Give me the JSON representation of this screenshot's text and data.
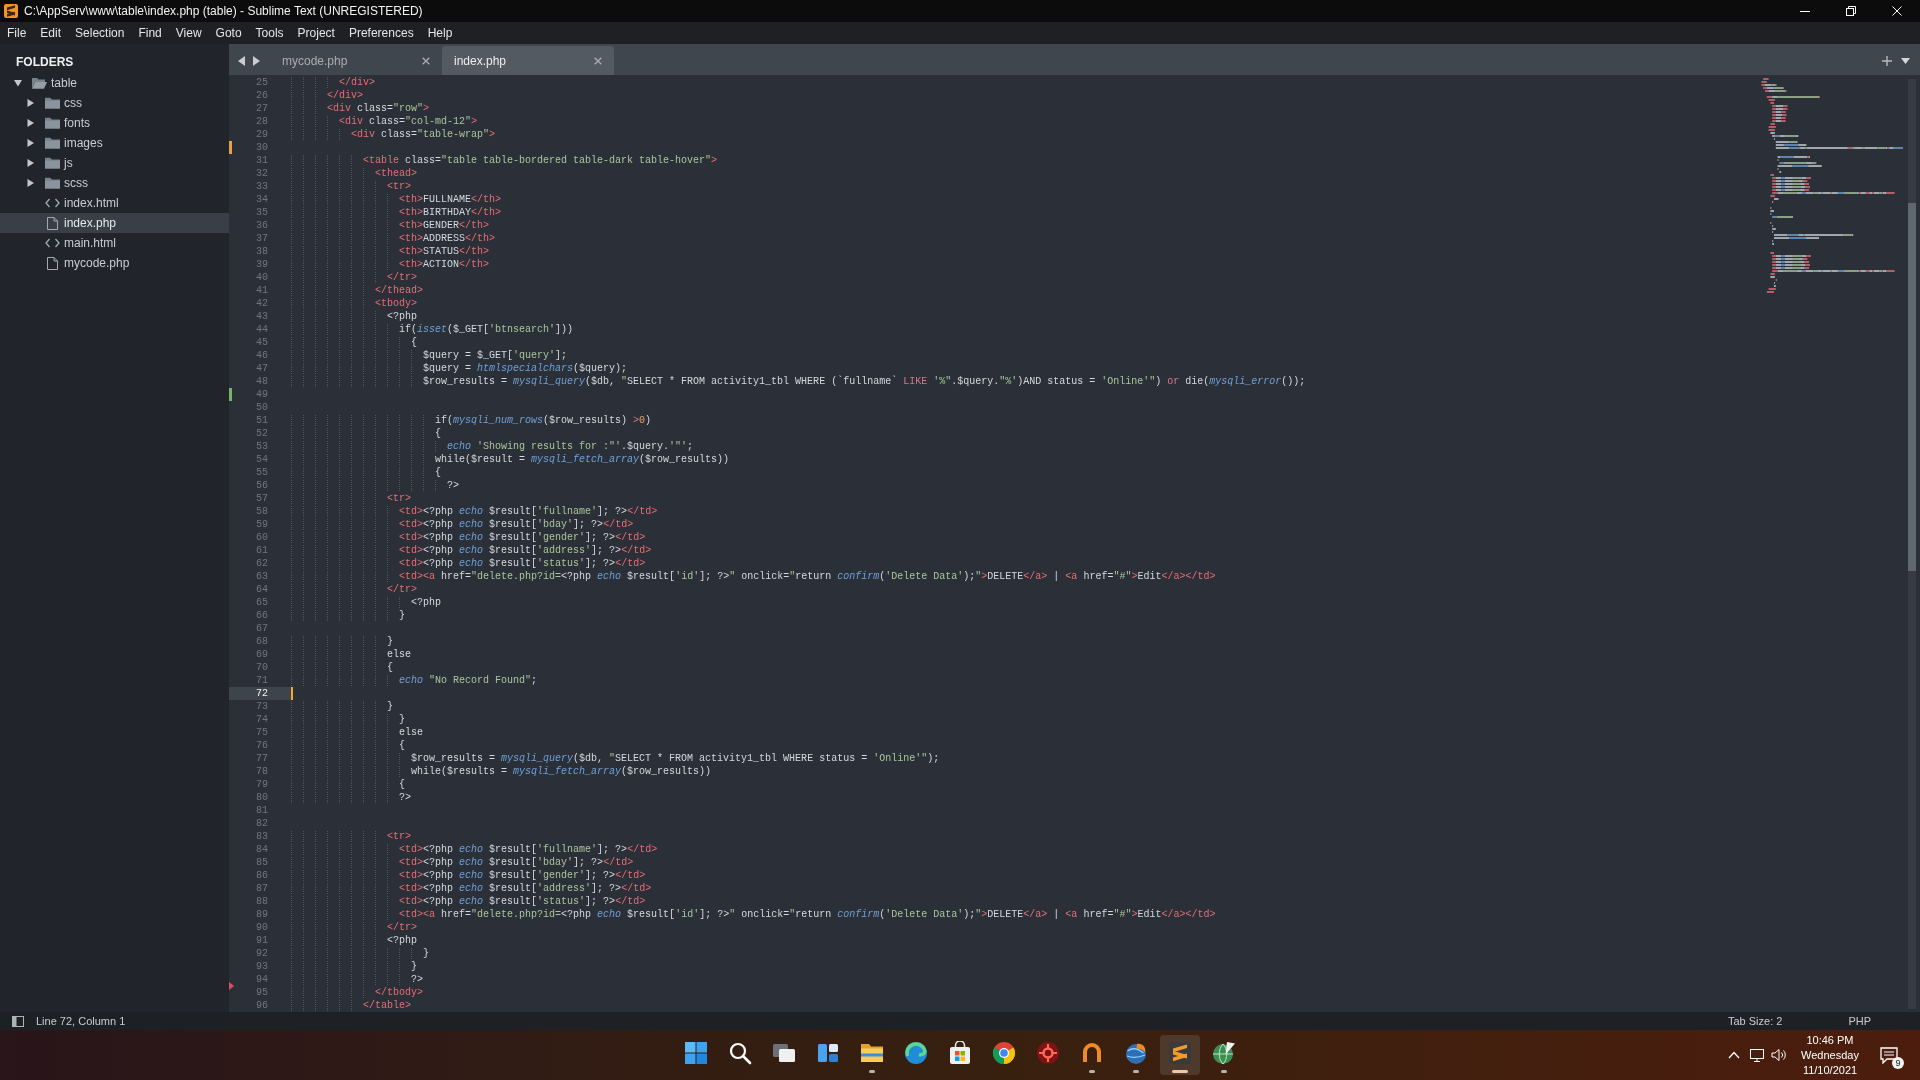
{
  "window": {
    "title": "C:\\AppServ\\www\\table\\index.php (table) - Sublime Text (UNREGISTERED)"
  },
  "menu": [
    "File",
    "Edit",
    "Selection",
    "Find",
    "View",
    "Goto",
    "Tools",
    "Project",
    "Preferences",
    "Help"
  ],
  "sidebar": {
    "header": "FOLDERS",
    "tree": [
      {
        "label": "table",
        "kind": "folder",
        "expanded": true,
        "selected": false,
        "children": [
          {
            "label": "css",
            "kind": "folder",
            "expanded": false,
            "selected": false
          },
          {
            "label": "fonts",
            "kind": "folder",
            "expanded": false,
            "selected": false
          },
          {
            "label": "images",
            "kind": "folder",
            "expanded": false,
            "selected": false
          },
          {
            "label": "js",
            "kind": "folder",
            "expanded": false,
            "selected": false
          },
          {
            "label": "scss",
            "kind": "folder",
            "expanded": false,
            "selected": false
          },
          {
            "label": "index.html",
            "kind": "markup",
            "selected": false
          },
          {
            "label": "index.php",
            "kind": "file",
            "selected": true
          },
          {
            "label": "main.html",
            "kind": "markup",
            "selected": false
          },
          {
            "label": "mycode.php",
            "kind": "file",
            "selected": false
          }
        ]
      }
    ]
  },
  "tabs": [
    {
      "label": "mycode.php",
      "selected": false
    },
    {
      "label": "index.php",
      "selected": true
    }
  ],
  "editor": {
    "lines": [
      {
        "number": "25",
        "kind": "plain",
        "current": false,
        "tokens": [
          {
            "kind": "tag",
            "text": "        </div>"
          }
        ]
      },
      {
        "number": "26",
        "kind": "plain",
        "current": false,
        "tokens": [
          {
            "kind": "tag",
            "text": "      </div>"
          }
        ]
      },
      {
        "number": "27",
        "kind": "plain",
        "current": false,
        "tokens": [
          {
            "kind": "tag",
            "text": "      <div"
          },
          {
            "kind": "txt",
            "text": " class="
          },
          {
            "kind": "str",
            "text": "\"row\""
          },
          {
            "kind": "tag",
            "text": ">"
          }
        ]
      },
      {
        "number": "28",
        "kind": "plain",
        "current": false,
        "tokens": [
          {
            "kind": "tag",
            "text": "        <div"
          },
          {
            "kind": "txt",
            "text": " class="
          },
          {
            "kind": "str",
            "text": "\"col-md-12\""
          },
          {
            "kind": "tag",
            "text": ">"
          }
        ]
      },
      {
        "number": "29",
        "kind": "plain",
        "current": false,
        "tokens": [
          {
            "kind": "tag",
            "text": "          <div"
          },
          {
            "kind": "txt",
            "text": " class="
          },
          {
            "kind": "str",
            "text": "\"table-wrap\""
          },
          {
            "kind": "tag",
            "text": ">"
          }
        ]
      },
      {
        "number": "30",
        "kind": "modified",
        "current": false
      },
      {
        "number": "31",
        "kind": "plain",
        "current": false,
        "tokens": [
          {
            "kind": "tag",
            "text": "            <table"
          },
          {
            "kind": "txt",
            "text": " class="
          },
          {
            "kind": "str",
            "text": "\"table table-bordered table-dark table-hover\""
          },
          {
            "kind": "tag",
            "text": ">"
          }
        ]
      },
      {
        "number": "32",
        "kind": "plain",
        "current": false,
        "tokens": [
          {
            "kind": "tag",
            "text": "              <thead>"
          }
        ]
      },
      {
        "number": "33",
        "kind": "plain",
        "current": false,
        "tokens": [
          {
            "kind": "tag",
            "text": "                <tr>"
          }
        ]
      },
      {
        "number": "34",
        "kind": "plain",
        "current": false,
        "tokens": [
          {
            "kind": "tag",
            "text": "                  <th>"
          },
          {
            "kind": "txt",
            "text": "FULLNAME"
          },
          {
            "kind": "tag",
            "text": "</th>"
          }
        ]
      },
      {
        "number": "35",
        "kind": "plain",
        "current": false,
        "tokens": [
          {
            "kind": "tag",
            "text": "                  <th>"
          },
          {
            "kind": "txt",
            "text": "BIRTHDAY"
          },
          {
            "kind": "tag",
            "text": "</th>"
          }
        ]
      },
      {
        "number": "36",
        "kind": "plain",
        "current": false,
        "tokens": [
          {
            "kind": "tag",
            "text": "                  <th>"
          },
          {
            "kind": "txt",
            "text": "GENDER"
          },
          {
            "kind": "tag",
            "text": "</th>"
          }
        ]
      },
      {
        "number": "37",
        "kind": "plain",
        "current": false,
        "tokens": [
          {
            "kind": "tag",
            "text": "                  <th>"
          },
          {
            "kind": "txt",
            "text": "ADDRESS"
          },
          {
            "kind": "tag",
            "text": "</th>"
          }
        ]
      },
      {
        "number": "38",
        "kind": "plain",
        "current": false,
        "tokens": [
          {
            "kind": "tag",
            "text": "                  <th>"
          },
          {
            "kind": "txt",
            "text": "STATUS"
          },
          {
            "kind": "tag",
            "text": "</th>"
          }
        ]
      },
      {
        "number": "39",
        "kind": "plain",
        "current": false,
        "tokens": [
          {
            "kind": "tag",
            "text": "                  <th>"
          },
          {
            "kind": "txt",
            "text": "ACTION"
          },
          {
            "kind": "tag",
            "text": "</th>"
          }
        ]
      },
      {
        "number": "40",
        "kind": "plain",
        "current": false,
        "tokens": [
          {
            "kind": "tag",
            "text": "                </tr>"
          }
        ]
      },
      {
        "number": "41",
        "kind": "plain",
        "current": false,
        "tokens": [
          {
            "kind": "tag",
            "text": "              </thead>"
          }
        ]
      },
      {
        "number": "42",
        "kind": "plain",
        "current": false,
        "tokens": [
          {
            "kind": "tag",
            "text": "              <tbody>"
          }
        ]
      },
      {
        "number": "43",
        "kind": "plain",
        "current": false,
        "tokens": [
          {
            "kind": "txt",
            "text": "                <?php"
          }
        ]
      },
      {
        "number": "44",
        "kind": "plain",
        "current": false,
        "tokens": [
          {
            "kind": "txt",
            "text": "                  if("
          },
          {
            "kind": "fn",
            "text": "isset"
          },
          {
            "kind": "txt",
            "text": "($_GET["
          },
          {
            "kind": "str",
            "text": "'btnsearch'"
          },
          {
            "kind": "txt",
            "text": "]))"
          }
        ]
      },
      {
        "number": "45",
        "kind": "plain",
        "current": false,
        "tokens": [
          {
            "kind": "txt",
            "text": "                    {"
          }
        ]
      },
      {
        "number": "46",
        "kind": "plain",
        "current": false,
        "tokens": [
          {
            "kind": "txt",
            "text": "                      $query = $_GET["
          },
          {
            "kind": "str",
            "text": "'query'"
          },
          {
            "kind": "txt",
            "text": "];"
          }
        ]
      },
      {
        "number": "47",
        "kind": "plain",
        "current": false,
        "tokens": [
          {
            "kind": "txt",
            "text": "                      $query = "
          },
          {
            "kind": "fn",
            "text": "htmlspecialchars"
          },
          {
            "kind": "txt",
            "text": "($query);"
          }
        ]
      },
      {
        "number": "48",
        "kind": "plain",
        "current": false,
        "tokens": [
          {
            "kind": "txt",
            "text": "                      $row_results = "
          },
          {
            "kind": "fn",
            "text": "mysqli_query"
          },
          {
            "kind": "txt",
            "text": "($db, "
          },
          {
            "kind": "str",
            "text": "\""
          },
          {
            "kind": "txt",
            "text": "SELECT * FROM activity1_tbl WHERE (`fullname` "
          },
          {
            "kind": "kw",
            "text": "LIKE "
          },
          {
            "kind": "str",
            "text": "'%\""
          },
          {
            "kind": "txt",
            "text": ".$query."
          },
          {
            "kind": "str",
            "text": "\"%'"
          },
          {
            "kind": "txt",
            "text": ")AND status = "
          },
          {
            "kind": "str",
            "text": "'Online'\""
          },
          {
            "kind": "txt",
            "text": ") "
          },
          {
            "kind": "kw",
            "text": "or"
          },
          {
            "kind": "txt",
            "text": " die("
          },
          {
            "kind": "fn",
            "text": "mysqli_error"
          },
          {
            "kind": "txt",
            "text": "());"
          }
        ]
      },
      {
        "number": "49",
        "kind": "added",
        "current": false
      },
      {
        "number": "50",
        "kind": "plain",
        "current": false
      },
      {
        "number": "51",
        "kind": "plain",
        "current": false,
        "tokens": [
          {
            "kind": "txt",
            "text": "                        if("
          },
          {
            "kind": "fn",
            "text": "mysqli_num_rows"
          },
          {
            "kind": "txt",
            "text": "($row_results) "
          },
          {
            "kind": "kw",
            "text": ">"
          },
          {
            "kind": "num",
            "text": "0"
          },
          {
            "kind": "txt",
            "text": ")"
          }
        ]
      },
      {
        "number": "52",
        "kind": "plain",
        "current": false,
        "tokens": [
          {
            "kind": "txt",
            "text": "                        {"
          }
        ]
      },
      {
        "number": "53",
        "kind": "plain",
        "current": false,
        "tokens": [
          {
            "kind": "fn",
            "text": "                          echo "
          },
          {
            "kind": "str",
            "text": "'Showing results for :\"'"
          },
          {
            "kind": "txt",
            "text": ".$query."
          },
          {
            "kind": "str",
            "text": "'\"'"
          },
          {
            "kind": "txt",
            "text": ";"
          }
        ]
      },
      {
        "number": "54",
        "kind": "plain",
        "current": false,
        "tokens": [
          {
            "kind": "txt",
            "text": "                        while($result = "
          },
          {
            "kind": "fn",
            "text": "mysqli_fetch_array"
          },
          {
            "kind": "txt",
            "text": "($row_results))"
          }
        ]
      },
      {
        "number": "55",
        "kind": "plain",
        "current": false,
        "tokens": [
          {
            "kind": "txt",
            "text": "                        {"
          }
        ]
      },
      {
        "number": "56",
        "kind": "plain",
        "current": false,
        "tokens": [
          {
            "kind": "txt",
            "text": "                          ?>"
          }
        ]
      },
      {
        "number": "57",
        "kind": "plain",
        "current": false,
        "tokens": [
          {
            "kind": "tag",
            "text": "                <tr>"
          }
        ]
      },
      {
        "number": "58",
        "kind": "plain",
        "current": false,
        "tokens": [
          {
            "kind": "tag",
            "text": "                  <td>"
          },
          {
            "kind": "txt",
            "text": "<?php "
          },
          {
            "kind": "fn",
            "text": "echo"
          },
          {
            "kind": "txt",
            "text": " $result["
          },
          {
            "kind": "str",
            "text": "'fullname'"
          },
          {
            "kind": "txt",
            "text": "]; ?>"
          },
          {
            "kind": "tag",
            "text": "</td>"
          }
        ]
      },
      {
        "number": "59",
        "kind": "plain",
        "current": false,
        "tokens": [
          {
            "kind": "tag",
            "text": "                  <td>"
          },
          {
            "kind": "txt",
            "text": "<?php "
          },
          {
            "kind": "fn",
            "text": "echo"
          },
          {
            "kind": "txt",
            "text": " $result["
          },
          {
            "kind": "str",
            "text": "'bday'"
          },
          {
            "kind": "txt",
            "text": "]; ?>"
          },
          {
            "kind": "tag",
            "text": "</td>"
          }
        ]
      },
      {
        "number": "60",
        "kind": "plain",
        "current": false,
        "tokens": [
          {
            "kind": "tag",
            "text": "                  <td>"
          },
          {
            "kind": "txt",
            "text": "<?php "
          },
          {
            "kind": "fn",
            "text": "echo"
          },
          {
            "kind": "txt",
            "text": " $result["
          },
          {
            "kind": "str",
            "text": "'gender'"
          },
          {
            "kind": "txt",
            "text": "]; ?>"
          },
          {
            "kind": "tag",
            "text": "</td>"
          }
        ]
      },
      {
        "number": "61",
        "kind": "plain",
        "current": false,
        "tokens": [
          {
            "kind": "tag",
            "text": "                  <td>"
          },
          {
            "kind": "txt",
            "text": "<?php "
          },
          {
            "kind": "fn",
            "text": "echo"
          },
          {
            "kind": "txt",
            "text": " $result["
          },
          {
            "kind": "str",
            "text": "'address'"
          },
          {
            "kind": "txt",
            "text": "]; ?>"
          },
          {
            "kind": "tag",
            "text": "</td>"
          }
        ]
      },
      {
        "number": "62",
        "kind": "plain",
        "current": false,
        "tokens": [
          {
            "kind": "tag",
            "text": "                  <td>"
          },
          {
            "kind": "txt",
            "text": "<?php "
          },
          {
            "kind": "fn",
            "text": "echo"
          },
          {
            "kind": "txt",
            "text": " $result["
          },
          {
            "kind": "str",
            "text": "'status'"
          },
          {
            "kind": "txt",
            "text": "]; ?>"
          },
          {
            "kind": "tag",
            "text": "</td>"
          }
        ]
      },
      {
        "number": "63",
        "kind": "plain",
        "current": false,
        "tokens": [
          {
            "kind": "tag",
            "text": "                  <td><a"
          },
          {
            "kind": "txt",
            "text": " href="
          },
          {
            "kind": "str",
            "text": "\"delete.php?id="
          },
          {
            "kind": "txt",
            "text": "<?php "
          },
          {
            "kind": "fn",
            "text": "echo"
          },
          {
            "kind": "txt",
            "text": " $result["
          },
          {
            "kind": "str",
            "text": "'id'"
          },
          {
            "kind": "txt",
            "text": "]; ?>"
          },
          {
            "kind": "str",
            "text": "\""
          },
          {
            "kind": "txt",
            "text": " onclick="
          },
          {
            "kind": "str",
            "text": "\""
          },
          {
            "kind": "txt",
            "text": "return "
          },
          {
            "kind": "fn",
            "text": "confirm"
          },
          {
            "kind": "txt",
            "text": "("
          },
          {
            "kind": "str",
            "text": "'Delete Data'"
          },
          {
            "kind": "txt",
            "text": ");"
          },
          {
            "kind": "str",
            "text": "\""
          },
          {
            "kind": "tag",
            "text": ">"
          },
          {
            "kind": "txt",
            "text": "DELETE"
          },
          {
            "kind": "tag",
            "text": "</a>"
          },
          {
            "kind": "txt",
            "text": " | "
          },
          {
            "kind": "tag",
            "text": "<a"
          },
          {
            "kind": "txt",
            "text": " href="
          },
          {
            "kind": "str",
            "text": "\"#\""
          },
          {
            "kind": "tag",
            "text": ">"
          },
          {
            "kind": "txt",
            "text": "Edit"
          },
          {
            "kind": "tag",
            "text": "</a></td>"
          }
        ]
      },
      {
        "number": "64",
        "kind": "plain",
        "current": false,
        "tokens": [
          {
            "kind": "tag",
            "text": "                </tr>"
          }
        ]
      },
      {
        "number": "65",
        "kind": "plain",
        "current": false,
        "tokens": [
          {
            "kind": "txt",
            "text": "                    <?php"
          }
        ]
      },
      {
        "number": "66",
        "kind": "plain",
        "current": false,
        "tokens": [
          {
            "kind": "txt",
            "text": "                  }"
          }
        ]
      },
      {
        "number": "67",
        "kind": "plain",
        "current": false
      },
      {
        "number": "68",
        "kind": "plain",
        "current": false,
        "tokens": [
          {
            "kind": "txt",
            "text": "                }"
          }
        ]
      },
      {
        "number": "69",
        "kind": "plain",
        "current": false,
        "tokens": [
          {
            "kind": "txt",
            "text": "                else"
          }
        ]
      },
      {
        "number": "70",
        "kind": "plain",
        "current": false,
        "tokens": [
          {
            "kind": "txt",
            "text": "                {"
          }
        ]
      },
      {
        "number": "71",
        "kind": "plain",
        "current": false,
        "tokens": [
          {
            "kind": "fn",
            "text": "                  echo "
          },
          {
            "kind": "str",
            "text": "\"No Record Found\""
          },
          {
            "kind": "txt",
            "text": ";"
          }
        ]
      },
      {
        "number": "72",
        "kind": "plain",
        "current": true
      },
      {
        "number": "73",
        "kind": "plain",
        "current": false,
        "tokens": [
          {
            "kind": "txt",
            "text": "                }"
          }
        ]
      },
      {
        "number": "74",
        "kind": "plain",
        "current": false,
        "tokens": [
          {
            "kind": "txt",
            "text": "                  }"
          }
        ]
      },
      {
        "number": "75",
        "kind": "plain",
        "current": false,
        "tokens": [
          {
            "kind": "txt",
            "text": "                  else"
          }
        ]
      },
      {
        "number": "76",
        "kind": "plain",
        "current": false,
        "tokens": [
          {
            "kind": "txt",
            "text": "                  {"
          }
        ]
      },
      {
        "number": "77",
        "kind": "plain",
        "current": false,
        "tokens": [
          {
            "kind": "txt",
            "text": "                    $row_results = "
          },
          {
            "kind": "fn",
            "text": "mysqli_query"
          },
          {
            "kind": "txt",
            "text": "($db, "
          },
          {
            "kind": "str",
            "text": "\""
          },
          {
            "kind": "txt",
            "text": "SELECT * FROM activity1_tbl WHERE status = "
          },
          {
            "kind": "str",
            "text": "'Online'\""
          },
          {
            "kind": "txt",
            "text": ");"
          }
        ]
      },
      {
        "number": "78",
        "kind": "plain",
        "current": false,
        "tokens": [
          {
            "kind": "txt",
            "text": "                    while($results = "
          },
          {
            "kind": "fn",
            "text": "mysqli_fetch_array"
          },
          {
            "kind": "txt",
            "text": "($row_results))"
          }
        ]
      },
      {
        "number": "79",
        "kind": "plain",
        "current": false,
        "tokens": [
          {
            "kind": "txt",
            "text": "                  {"
          }
        ]
      },
      {
        "number": "80",
        "kind": "plain",
        "current": false,
        "tokens": [
          {
            "kind": "txt",
            "text": "                  ?>"
          }
        ]
      },
      {
        "number": "81",
        "kind": "plain",
        "current": false
      },
      {
        "number": "82",
        "kind": "plain",
        "current": false
      },
      {
        "number": "83",
        "kind": "plain",
        "current": false,
        "tokens": [
          {
            "kind": "tag",
            "text": "                <tr>"
          }
        ]
      },
      {
        "number": "84",
        "kind": "plain",
        "current": false,
        "tokens": [
          {
            "kind": "tag",
            "text": "                  <td>"
          },
          {
            "kind": "txt",
            "text": "<?php "
          },
          {
            "kind": "fn",
            "text": "echo"
          },
          {
            "kind": "txt",
            "text": " $result["
          },
          {
            "kind": "str",
            "text": "'fullname'"
          },
          {
            "kind": "txt",
            "text": "]; ?>"
          },
          {
            "kind": "tag",
            "text": "</td>"
          }
        ]
      },
      {
        "number": "85",
        "kind": "plain",
        "current": false,
        "tokens": [
          {
            "kind": "tag",
            "text": "                  <td>"
          },
          {
            "kind": "txt",
            "text": "<?php "
          },
          {
            "kind": "fn",
            "text": "echo"
          },
          {
            "kind": "txt",
            "text": " $result["
          },
          {
            "kind": "str",
            "text": "'bday'"
          },
          {
            "kind": "txt",
            "text": "]; ?>"
          },
          {
            "kind": "tag",
            "text": "</td>"
          }
        ]
      },
      {
        "number": "86",
        "kind": "plain",
        "current": false,
        "tokens": [
          {
            "kind": "tag",
            "text": "                  <td>"
          },
          {
            "kind": "txt",
            "text": "<?php "
          },
          {
            "kind": "fn",
            "text": "echo"
          },
          {
            "kind": "txt",
            "text": " $result["
          },
          {
            "kind": "str",
            "text": "'gender'"
          },
          {
            "kind": "txt",
            "text": "]; ?>"
          },
          {
            "kind": "tag",
            "text": "</td>"
          }
        ]
      },
      {
        "number": "87",
        "kind": "plain",
        "current": false,
        "tokens": [
          {
            "kind": "tag",
            "text": "                  <td>"
          },
          {
            "kind": "txt",
            "text": "<?php "
          },
          {
            "kind": "fn",
            "text": "echo"
          },
          {
            "kind": "txt",
            "text": " $result["
          },
          {
            "kind": "str",
            "text": "'address'"
          },
          {
            "kind": "txt",
            "text": "]; ?>"
          },
          {
            "kind": "tag",
            "text": "</td>"
          }
        ]
      },
      {
        "number": "88",
        "kind": "plain",
        "current": false,
        "tokens": [
          {
            "kind": "tag",
            "text": "                  <td>"
          },
          {
            "kind": "txt",
            "text": "<?php "
          },
          {
            "kind": "fn",
            "text": "echo"
          },
          {
            "kind": "txt",
            "text": " $result["
          },
          {
            "kind": "str",
            "text": "'status'"
          },
          {
            "kind": "txt",
            "text": "]; ?>"
          },
          {
            "kind": "tag",
            "text": "</td>"
          }
        ]
      },
      {
        "number": "89",
        "kind": "plain",
        "current": false,
        "tokens": [
          {
            "kind": "tag",
            "text": "                  <td><a"
          },
          {
            "kind": "txt",
            "text": " href="
          },
          {
            "kind": "str",
            "text": "\"delete.php?id="
          },
          {
            "kind": "txt",
            "text": "<?php "
          },
          {
            "kind": "fn",
            "text": "echo"
          },
          {
            "kind": "txt",
            "text": " $result["
          },
          {
            "kind": "str",
            "text": "'id'"
          },
          {
            "kind": "txt",
            "text": "]; ?>"
          },
          {
            "kind": "str",
            "text": "\""
          },
          {
            "kind": "txt",
            "text": " onclick="
          },
          {
            "kind": "str",
            "text": "\""
          },
          {
            "kind": "txt",
            "text": "return "
          },
          {
            "kind": "fn",
            "text": "confirm"
          },
          {
            "kind": "txt",
            "text": "("
          },
          {
            "kind": "str",
            "text": "'Delete Data'"
          },
          {
            "kind": "txt",
            "text": ");"
          },
          {
            "kind": "str",
            "text": "\""
          },
          {
            "kind": "tag",
            "text": ">"
          },
          {
            "kind": "txt",
            "text": "DELETE"
          },
          {
            "kind": "tag",
            "text": "</a>"
          },
          {
            "kind": "txt",
            "text": " | "
          },
          {
            "kind": "tag",
            "text": "<a"
          },
          {
            "kind": "txt",
            "text": " href="
          },
          {
            "kind": "str",
            "text": "\"#\""
          },
          {
            "kind": "tag",
            "text": ">"
          },
          {
            "kind": "txt",
            "text": "Edit"
          },
          {
            "kind": "tag",
            "text": "</a></td>"
          }
        ]
      },
      {
        "number": "90",
        "kind": "plain",
        "current": false,
        "tokens": [
          {
            "kind": "tag",
            "text": "                </tr>"
          }
        ]
      },
      {
        "number": "91",
        "kind": "plain",
        "current": false,
        "tokens": [
          {
            "kind": "txt",
            "text": "                <?php"
          }
        ]
      },
      {
        "number": "92",
        "kind": "plain",
        "current": false,
        "tokens": [
          {
            "kind": "txt",
            "text": "                      }"
          }
        ]
      },
      {
        "number": "93",
        "kind": "plain",
        "current": false,
        "tokens": [
          {
            "kind": "txt",
            "text": "                    }"
          }
        ]
      },
      {
        "number": "94",
        "kind": "plain",
        "current": false,
        "tokens": [
          {
            "kind": "txt",
            "text": "                    ?>"
          }
        ]
      },
      {
        "number": "95",
        "kind": "deleted",
        "current": false,
        "tokens": [
          {
            "kind": "tag",
            "text": "              </tbody>"
          }
        ]
      },
      {
        "number": "96",
        "kind": "plain",
        "current": false,
        "tokens": [
          {
            "kind": "tag",
            "text": "            </table>"
          }
        ]
      }
    ]
  },
  "status_bar": {
    "position": "Line 72, Column 1",
    "tab_size": "Tab Size: 2",
    "syntax": "PHP"
  },
  "taskbar": {
    "apps": [
      {
        "kind": "start",
        "running": false,
        "active": false
      },
      {
        "kind": "search",
        "running": false,
        "active": false
      },
      {
        "kind": "task_view",
        "running": false,
        "active": false
      },
      {
        "kind": "widgets",
        "running": false,
        "active": false
      },
      {
        "kind": "folder",
        "running": true,
        "active": false
      },
      {
        "kind": "swirl",
        "running": false,
        "active": false
      },
      {
        "kind": "bag",
        "running": false,
        "active": false
      },
      {
        "kind": "segmented",
        "running": false,
        "active": false
      },
      {
        "kind": "spiked",
        "running": false,
        "active": false
      },
      {
        "kind": "horseshoe",
        "running": true,
        "active": false
      },
      {
        "kind": "globe_bird",
        "running": true,
        "active": false
      },
      {
        "kind": "s_tile",
        "running": true,
        "active": true
      },
      {
        "kind": "globe_pen",
        "running": true,
        "active": false
      }
    ],
    "clock": {
      "time": "10:46 PM",
      "day": "Wednesday",
      "date": "11/10/2021"
    },
    "notification_count": "9"
  }
}
